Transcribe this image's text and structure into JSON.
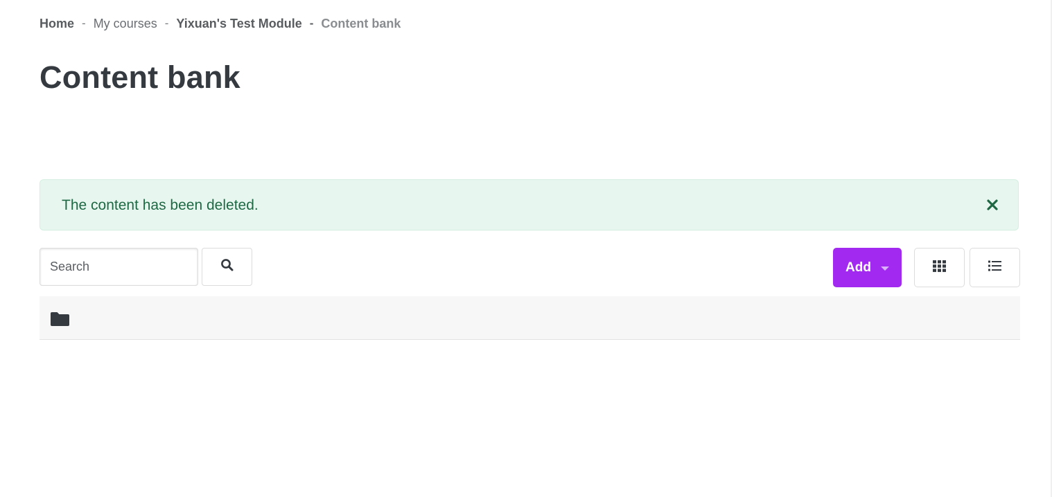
{
  "breadcrumb": {
    "home": "Home",
    "my_courses": "My courses",
    "course": "Yixuan's Test Module",
    "current": "Content bank",
    "separator": "-"
  },
  "page": {
    "title": "Content bank"
  },
  "alert": {
    "message": "The content has been deleted.",
    "close_icon": "close-icon",
    "color_bg": "#e7f7ef",
    "color_text": "#1e6844"
  },
  "search": {
    "placeholder": "Search",
    "button_icon": "search-icon"
  },
  "toolbar": {
    "add_label": "Add",
    "add_color": "#a22af0",
    "grid_view_icon": "grid-icon",
    "list_view_icon": "list-icon"
  },
  "folder": {
    "icon": "folder-icon"
  }
}
